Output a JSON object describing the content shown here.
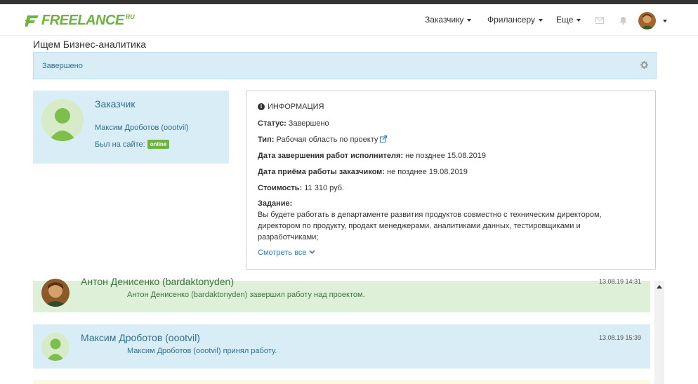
{
  "brand": {
    "name": "FREELANCE",
    "sup": "RU",
    "color": "#6db33f"
  },
  "nav": {
    "items": [
      {
        "label": "Заказчику"
      },
      {
        "label": "Фрилансеру"
      },
      {
        "label": "Еще"
      }
    ],
    "icons": [
      "envelope-icon",
      "bell-icon",
      "user-avatar"
    ]
  },
  "page": {
    "title": "Ищем Бизнес-аналитика"
  },
  "status": {
    "label": "Завершено"
  },
  "client": {
    "role": "Заказчик",
    "name": "Максим Дроботов (oootvil)",
    "seen_label": "Был на сайте:",
    "badge": "online"
  },
  "info": {
    "heading": "ИНФОРМАЦИЯ",
    "status": {
      "label": "Статус:",
      "value": "Завершено"
    },
    "type": {
      "label": "Тип:",
      "value": "Рабочая область по проекту"
    },
    "deadline": {
      "label": "Дата завершения работ исполнителя:",
      "value": "не позднее 15.08.2019"
    },
    "accept": {
      "label": "Дата приёма работы заказчиком:",
      "value": "не позднее 19.08.2019"
    },
    "cost": {
      "label": "Стоимость:",
      "value": "11 310 руб."
    },
    "task": {
      "label": "Задание:",
      "value": "Вы будете работать в департаменте развития продуктов совместно с техническим директором, директором по продукту, продакт менеджерами, аналитиками данных, тестировщиками и разработчиками;"
    },
    "show_all": "Смотреть все"
  },
  "messages": [
    {
      "author": "Антон Денисенко (bardaktonyden)",
      "time": "13.08.19 14:31",
      "text": "Антон Денисенко (bardaktonyden) завершил работу над проектом."
    },
    {
      "author": "Максим Дроботов (oootvil)",
      "time": "13.08.19 15:39",
      "text": "Максим Дроботов (oootvil) принял работу."
    }
  ]
}
